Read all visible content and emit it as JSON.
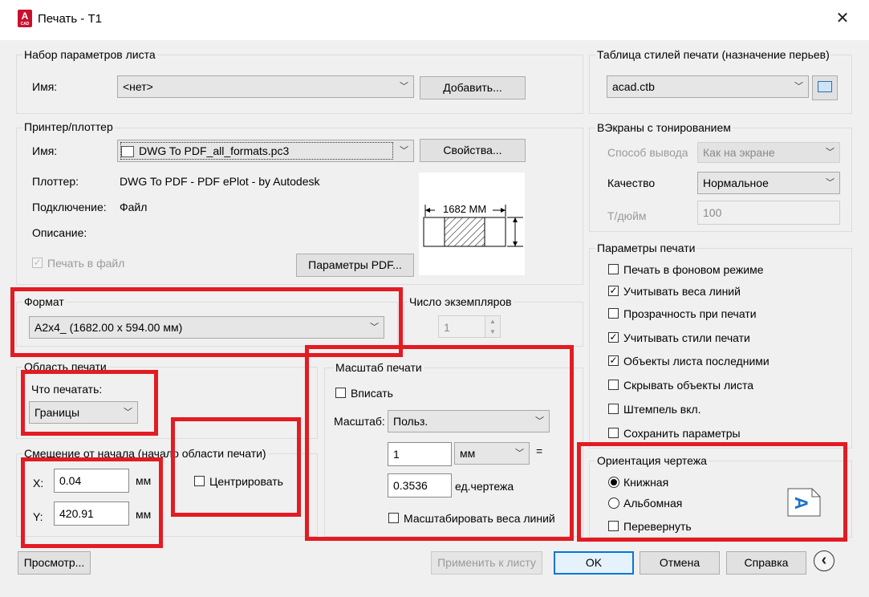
{
  "window": {
    "title": "Печать - T1",
    "app_icon_letter": "A",
    "app_icon_sub": "CAD",
    "close_glyph": "✕"
  },
  "page_setup": {
    "group_label": "Набор параметров листа",
    "name_label": "Имя:",
    "name_value": "<нет>",
    "add_button": "Добавить..."
  },
  "printer": {
    "group_label": "Принтер/плоттер",
    "name_label": "Имя:",
    "name_value": "DWG To PDF_all_formats.pc3",
    "properties_button": "Свойства...",
    "plotter_label": "Плоттер:",
    "plotter_value": "DWG To PDF - PDF ePlot - by Autodesk",
    "connection_label": "Подключение:",
    "connection_value": "Файл",
    "description_label": "Описание:",
    "print_to_file_label": "Печать в файл",
    "print_to_file_checked": true,
    "pdf_options_button": "Параметры PDF...",
    "preview_dimension": "1682  ММ"
  },
  "paper_size": {
    "group_label": "Формат",
    "value": "A2x4_ (1682.00 x 594.00 мм)"
  },
  "copies": {
    "group_label": "Число экземпляров",
    "value": "1"
  },
  "plot_area": {
    "group_label": "Область печати",
    "what_label": "Что печатать:",
    "what_value": "Границы"
  },
  "plot_offset": {
    "group_label": "Смещение от начала (начало области печати)",
    "x_label": "X:",
    "x_value": "0.04",
    "x_unit": "мм",
    "y_label": "Y:",
    "y_value": "420.91",
    "y_unit": "мм",
    "center_label": "Центрировать"
  },
  "plot_scale": {
    "group_label": "Масштаб печати",
    "fit_label": "Вписать",
    "scale_label": "Масштаб:",
    "scale_value": "Польз.",
    "value1": "1",
    "unit_value": "мм",
    "equals": "=",
    "value2": "0.3536",
    "drawing_units": "ед.чертежа",
    "scale_lineweights_label": "Масштабировать веса линий"
  },
  "style_table": {
    "group_label": "Таблица стилей печати (назначение перьев)",
    "value": "acad.ctb"
  },
  "shaded": {
    "group_label": "ВЭкраны с тонированием",
    "output_label": "Способ вывода",
    "output_value": "Как на экране",
    "quality_label": "Качество",
    "quality_value": "Нормальное",
    "dpi_label": "Т/дюйм",
    "dpi_value": "100"
  },
  "plot_options": {
    "group_label": "Параметры печати",
    "items": [
      {
        "label": "Печать в фоновом режиме",
        "checked": false
      },
      {
        "label": "Учитывать веса линий",
        "checked": true
      },
      {
        "label": "Прозрачность при печати",
        "checked": false
      },
      {
        "label": "Учитывать стили печати",
        "checked": true
      },
      {
        "label": "Объекты листа последними",
        "checked": true
      },
      {
        "label": "Скрывать объекты листа",
        "checked": false
      },
      {
        "label": "Штемпель вкл.",
        "checked": false
      },
      {
        "label": "Сохранить параметры",
        "checked": false
      }
    ]
  },
  "orientation": {
    "group_label": "Ориентация чертежа",
    "portrait_label": "Книжная",
    "landscape_label": "Альбомная",
    "flip_label": "Перевернуть",
    "icon_letter": "A"
  },
  "footer": {
    "preview_button": "Просмотр...",
    "apply_button": "Применить к листу",
    "ok_button": "OK",
    "cancel_button": "Отмена",
    "help_button": "Справка",
    "collapse_glyph": "‹"
  },
  "colors": {
    "highlight": "#e31b23",
    "accent": "#0078d7"
  },
  "check_glyph": "✓"
}
